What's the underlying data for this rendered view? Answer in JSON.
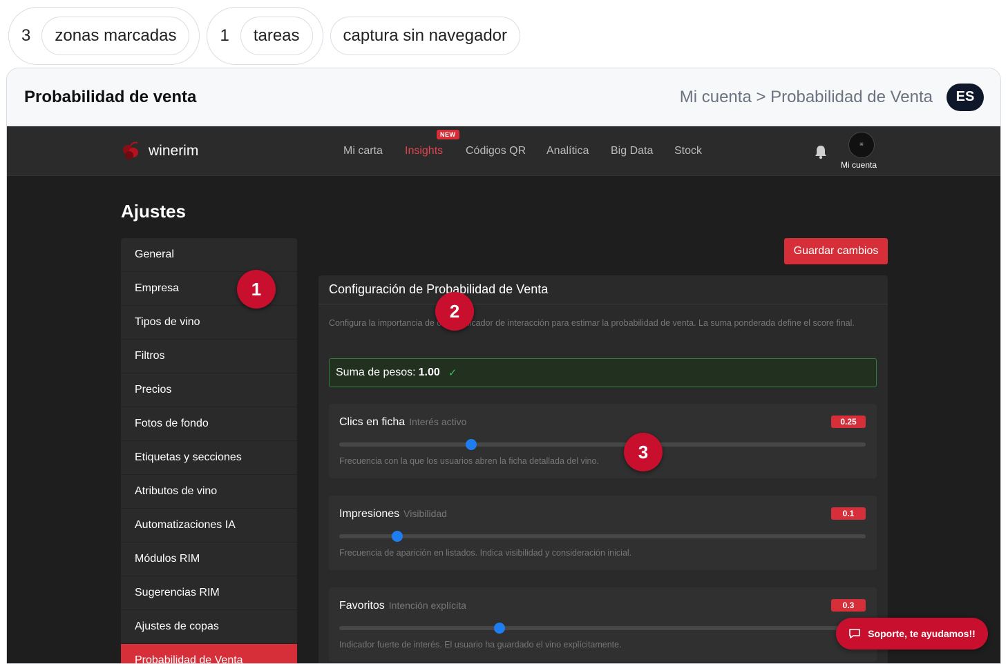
{
  "chips": [
    {
      "count": "3",
      "label": "zonas marcadas"
    },
    {
      "count": "1",
      "label": "tareas"
    }
  ],
  "capture_label": "captura sin navegador",
  "header": {
    "title": "Probabilidad de venta",
    "breadcrumb": "Mi cuenta > Probabilidad de Venta",
    "lang": "ES"
  },
  "nav": {
    "brand": "winerim",
    "items": [
      "Mi carta",
      "Insights",
      "Códigos QR",
      "Analítica",
      "Big Data",
      "Stock"
    ],
    "new_badge": "NEW",
    "account_label": "Mi cuenta",
    "accent": "#d62f3a"
  },
  "page": {
    "title": "Ajustes",
    "save_label": "Guardar cambios"
  },
  "sidebar": {
    "items": [
      "General",
      "Empresa",
      "Tipos de vino",
      "Filtros",
      "Precios",
      "Fotos de fondo",
      "Etiquetas y secciones",
      "Atributos de vino",
      "Automatizaciones IA",
      "Módulos RIM",
      "Sugerencias RIM",
      "Ajustes de copas",
      "Probabilidad de Venta"
    ],
    "active_index": 12
  },
  "panel": {
    "title": "Configuración de Probabilidad de Venta",
    "description": "Configura la importancia de cada indicador de interacción para estimar la probabilidad de venta. La suma ponderada define el score final.",
    "sum_label": "Suma de pesos:",
    "sum_value": "1.00"
  },
  "weights": [
    {
      "label": "Clics en ficha",
      "sub": "Interés activo",
      "value": "0.25",
      "fraction": 0.25,
      "desc": "Frecuencia con la que los usuarios abren la ficha detallada del vino."
    },
    {
      "label": "Impresiones",
      "sub": "Visibilidad",
      "value": "0.1",
      "fraction": 0.11,
      "desc": "Frecuencia de aparición en listados. Indica visibilidad y consideración inicial."
    },
    {
      "label": "Favoritos",
      "sub": "Intención explícita",
      "value": "0.3",
      "fraction": 0.305,
      "desc": "Indicador fuerte de interés. El usuario ha guardado el vino explícitamente."
    }
  ],
  "markers": [
    "1",
    "2",
    "3"
  ],
  "support_label": "Soporte, te ayudamos!!"
}
